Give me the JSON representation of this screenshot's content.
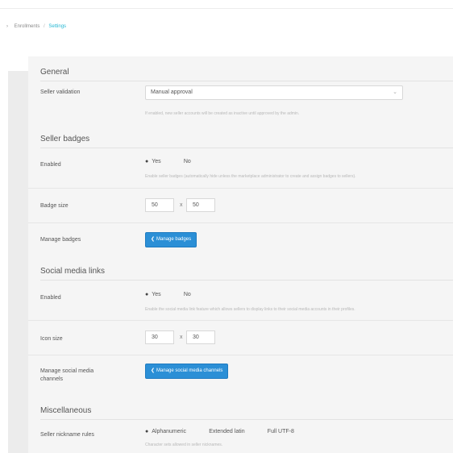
{
  "breadcrumb": {
    "home_icon": "chevron-right-icon",
    "parent": "Enrollments",
    "separator": "/",
    "current": "Settings"
  },
  "sections": {
    "general": {
      "title": "General"
    },
    "badges": {
      "title": "Seller badges"
    },
    "social": {
      "title": "Social media links"
    },
    "misc": {
      "title": "Miscellaneous"
    }
  },
  "seller_validation": {
    "label": "Seller validation",
    "value": "Manual approval",
    "help": "If enabled, new seller accounts will be created as inactive until approved by the admin."
  },
  "badges_enabled": {
    "label": "Enabled",
    "options": [
      "Yes",
      "No"
    ],
    "selected": "Yes",
    "help": "Enable seller badges (automatically hide unless the marketplace administrator to create and assign badges to sellers)."
  },
  "badge_size": {
    "label": "Badge size",
    "width": "50",
    "times": "x",
    "height": "50"
  },
  "manage_badges": {
    "label": "Manage badges",
    "button": "Manage badges"
  },
  "social_enabled": {
    "label": "Enabled",
    "options": [
      "Yes",
      "No"
    ],
    "selected": "Yes",
    "help": "Enable the social media link feature which allows sellers to display links to their social media accounts in their profiles."
  },
  "icon_size": {
    "label": "Icon size",
    "width": "30",
    "times": "x",
    "height": "30"
  },
  "manage_social": {
    "label_line1": "Manage social media",
    "label_line2": "channels",
    "button": "Manage social media channels"
  },
  "nickname_rules": {
    "label": "Seller nickname rules",
    "options": [
      "Alphanumeric",
      "Extended latin",
      "Full UTF-8"
    ],
    "selected": "Alphanumeric",
    "help": "Character sets allowed in seller nicknames."
  }
}
